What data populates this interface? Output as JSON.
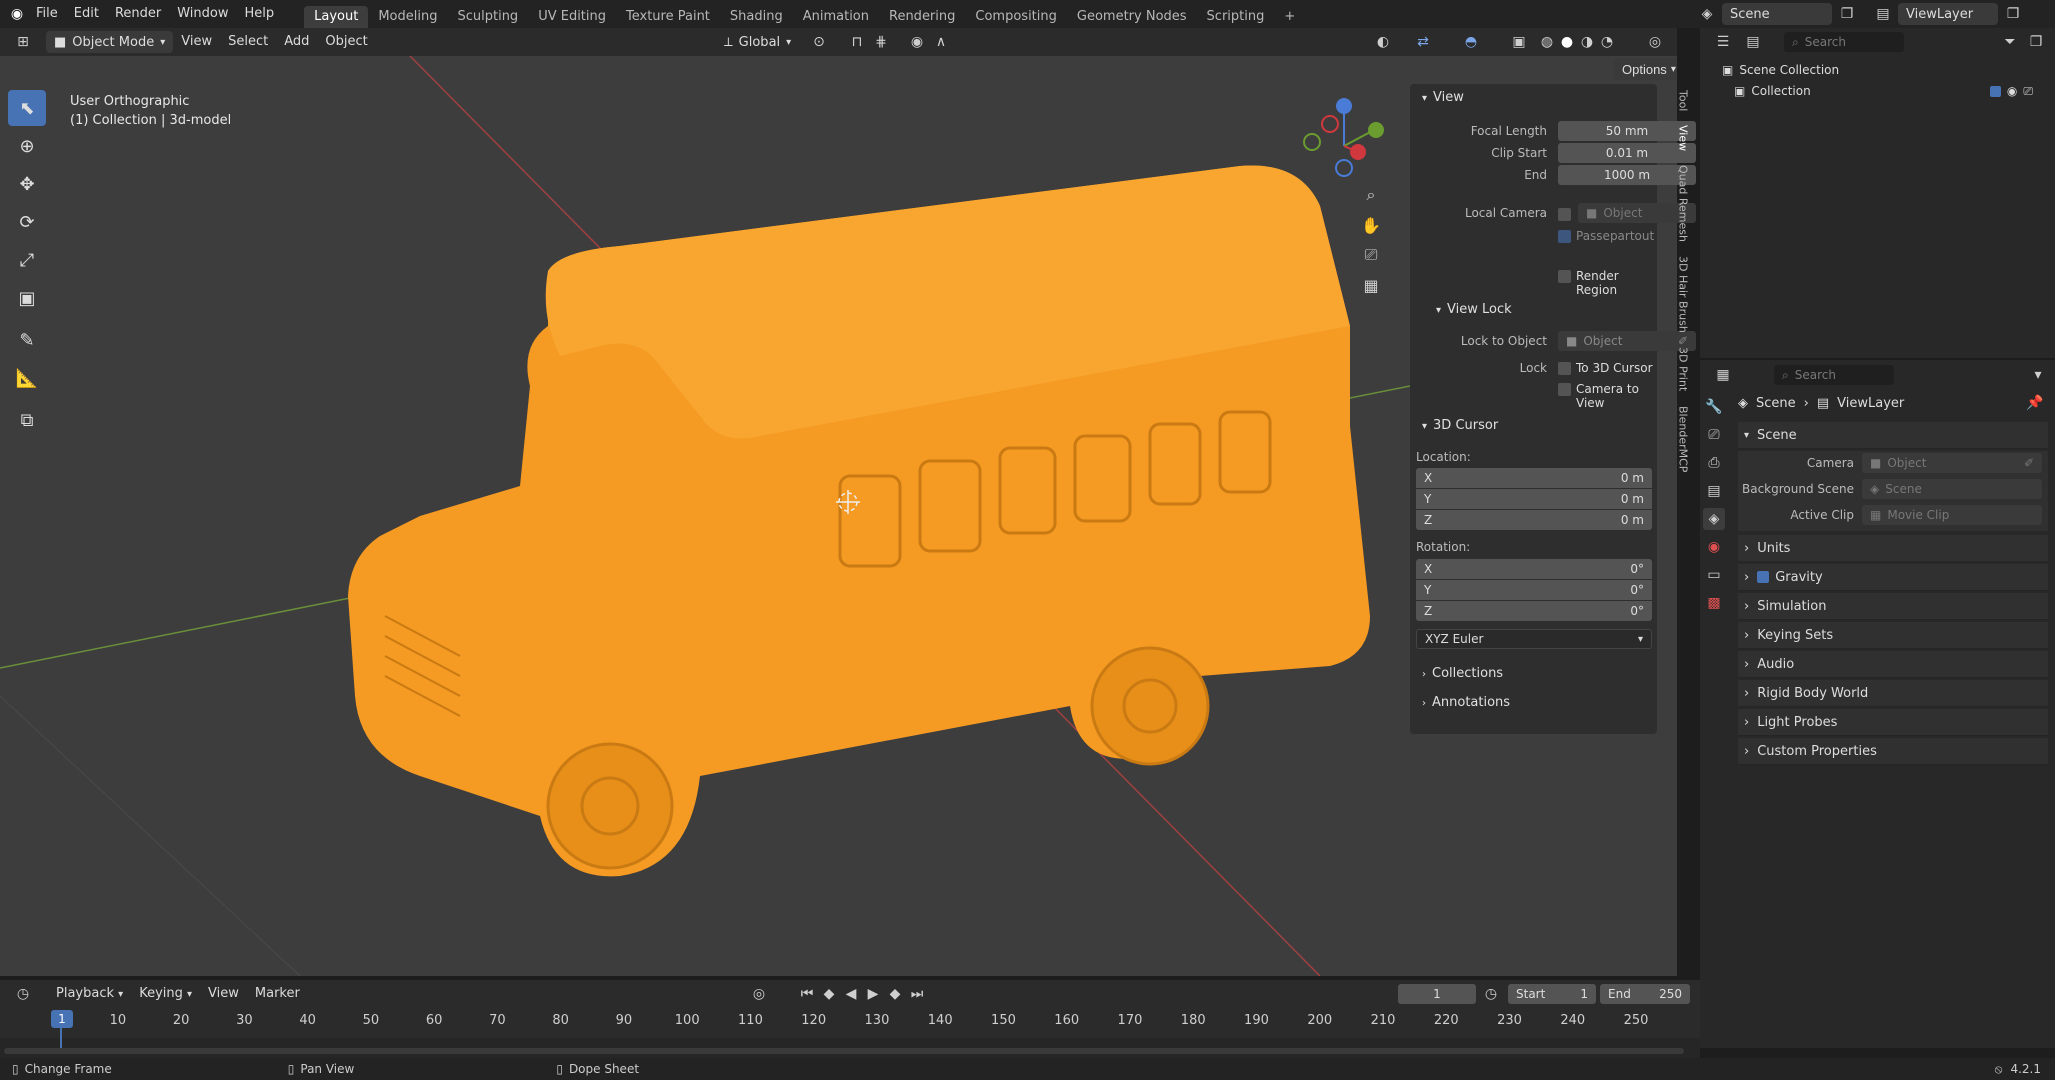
{
  "topbar": {
    "menus": [
      "File",
      "Edit",
      "Render",
      "Window",
      "Help"
    ],
    "workspaces": [
      "Layout",
      "Modeling",
      "Sculpting",
      "UV Editing",
      "Texture Paint",
      "Shading",
      "Animation",
      "Rendering",
      "Compositing",
      "Geometry Nodes",
      "Scripting"
    ],
    "active_workspace": "Layout",
    "scene_name": "Scene",
    "view_layer": "ViewLayer"
  },
  "viewport_header": {
    "mode": "Object Mode",
    "menus": [
      "View",
      "Select",
      "Add",
      "Object"
    ],
    "transform_orientation": "Global",
    "options_label": "Options"
  },
  "viewport": {
    "view_name": "User Orthographic",
    "collection_info": "(1) Collection | 3d-model",
    "object_color": "#f59a23"
  },
  "npanel": {
    "view": {
      "title": "View",
      "focal_length_label": "Focal Length",
      "focal_length": "50 mm",
      "clip_start_label": "Clip Start",
      "clip_start": "0.01 m",
      "end_label": "End",
      "end": "1000 m",
      "local_camera_label": "Local Camera",
      "local_camera_placeholder": "Object",
      "passepartout": "Passepartout",
      "render_region": "Render Region"
    },
    "view_lock": {
      "title": "View Lock",
      "lock_to_object_label": "Lock to Object",
      "lock_to_object_placeholder": "Object",
      "lock_label": "Lock",
      "to_3d_cursor": "To 3D Cursor",
      "camera_to_view": "Camera to View"
    },
    "cursor": {
      "title": "3D Cursor",
      "location_label": "Location:",
      "location": [
        {
          "axis": "X",
          "value": "0 m"
        },
        {
          "axis": "Y",
          "value": "0 m"
        },
        {
          "axis": "Z",
          "value": "0 m"
        }
      ],
      "rotation_label": "Rotation:",
      "rotation": [
        {
          "axis": "X",
          "value": "0°"
        },
        {
          "axis": "Y",
          "value": "0°"
        },
        {
          "axis": "Z",
          "value": "0°"
        }
      ],
      "rotation_mode": "XYZ Euler"
    },
    "collections": "Collections",
    "annotations": "Annotations",
    "side_tabs": [
      "Tool",
      "View",
      "Quad Remesh",
      "3D Hair Brush",
      "3D Print",
      "BlenderMCP"
    ]
  },
  "outliner": {
    "search_placeholder": "Search",
    "scene_collection": "Scene Collection",
    "collection": "Collection"
  },
  "properties": {
    "search_placeholder": "Search",
    "breadcrumb_scene": "Scene",
    "breadcrumb_viewlayer": "ViewLayer",
    "scene_panel_title": "Scene",
    "camera_label": "Camera",
    "camera_placeholder": "Object",
    "background_scene_label": "Background Scene",
    "background_scene_placeholder": "Scene",
    "active_clip_label": "Active Clip",
    "active_clip_placeholder": "Movie Clip",
    "panels": [
      "Units",
      "Gravity",
      "Simulation",
      "Keying Sets",
      "Audio",
      "Rigid Body World",
      "Light Probes",
      "Custom Properties"
    ]
  },
  "timeline": {
    "menus": [
      "Playback",
      "Keying",
      "View",
      "Marker"
    ],
    "current_frame": "1",
    "start_label": "Start",
    "start": "1",
    "end_label": "End",
    "end": "250",
    "ticks": [
      "1",
      "10",
      "20",
      "30",
      "40",
      "50",
      "60",
      "70",
      "80",
      "90",
      "100",
      "110",
      "120",
      "130",
      "140",
      "150",
      "160",
      "170",
      "180",
      "190",
      "200",
      "210",
      "220",
      "230",
      "240",
      "250"
    ]
  },
  "statusbar": {
    "left": "Change Frame",
    "middle": "Pan View",
    "right": "Dope Sheet",
    "version": "4.2.1"
  }
}
